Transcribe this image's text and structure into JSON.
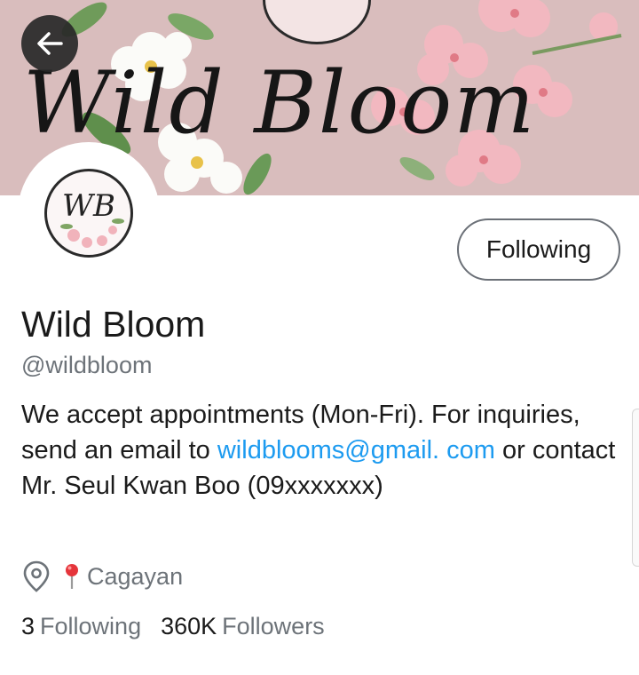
{
  "banner": {
    "title": "Wild Bloom",
    "background_color": "#d9bdbd",
    "logo_initials": "WB"
  },
  "back_button": {
    "icon": "arrow-left-icon"
  },
  "avatar": {
    "initials": "WB"
  },
  "follow_button": {
    "label": "Following"
  },
  "profile": {
    "name": "Wild Bloom",
    "handle": "@wildbloom",
    "bio": {
      "part1": "We accept appointments (Mon-Fri).  For inquiries,  send an email to ",
      "email": "wildblooms@gmail. com",
      "part2": " or contact Mr. Seul Kwan Boo (09xxxxxxx)"
    },
    "location": {
      "icon": "location-pin-icon",
      "emoji_icon": "red-pin-icon",
      "text": "Cagayan"
    },
    "stats": {
      "following_count": "3",
      "following_label": "Following",
      "followers_count": "360K",
      "followers_label": "Followers"
    }
  },
  "colors": {
    "link": "#1d9bf0",
    "secondary_text": "#6d7379"
  }
}
